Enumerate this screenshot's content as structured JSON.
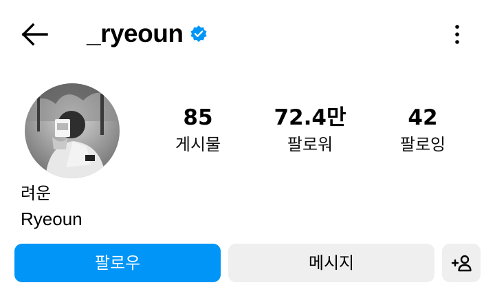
{
  "header": {
    "username": "_ryeoun",
    "verified": true,
    "icons": {
      "back": "arrow-left-icon",
      "verified": "verified-badge-icon",
      "more": "more-vertical-icon"
    }
  },
  "profile": {
    "avatar": "profile-photo",
    "display_name": "려운",
    "bio_name": "Ryeoun"
  },
  "stats": {
    "posts": {
      "value": "85",
      "label": "게시물"
    },
    "followers": {
      "value": "72.4만",
      "label": "팔로워"
    },
    "following": {
      "value": "42",
      "label": "팔로잉"
    }
  },
  "actions": {
    "follow_label": "팔로우",
    "message_label": "메시지",
    "suggest_icon": "person-add-icon"
  },
  "colors": {
    "primary": "#0095f6",
    "secondary_button": "#efefef",
    "verified_badge": "#0095f6",
    "text": "#000000"
  }
}
